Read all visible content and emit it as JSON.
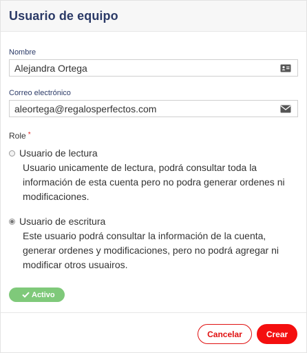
{
  "modal": {
    "title": "Usuario de equipo"
  },
  "form": {
    "name": {
      "label": "Nombre",
      "value": "Alejandra Ortega",
      "icon": "id-card-icon"
    },
    "email": {
      "label": "Correo electrónico",
      "value": "aleortega@regalosperfectos.com",
      "icon": "envelope-icon"
    },
    "role": {
      "label": "Role",
      "required_mark": "*",
      "options": [
        {
          "label": "Usuario de lectura",
          "description": "Usuario unicamente de lectura, podrá consultar toda la información de esta cuenta pero no podra generar ordenes ni modificaciones.",
          "selected": false
        },
        {
          "label": "Usuario de escritura",
          "description": "Este usuario podrá consultar la información de la cuenta, generar ordenes y modificaciones, pero no podrá agregar ni modificar otros usuairos.",
          "selected": true
        }
      ]
    },
    "status": {
      "label": "Activo",
      "icon": "check-icon",
      "color": "#7fc97a"
    }
  },
  "footer": {
    "cancel_label": "Cancelar",
    "create_label": "Crear",
    "accent_color": "#f40f0f"
  }
}
